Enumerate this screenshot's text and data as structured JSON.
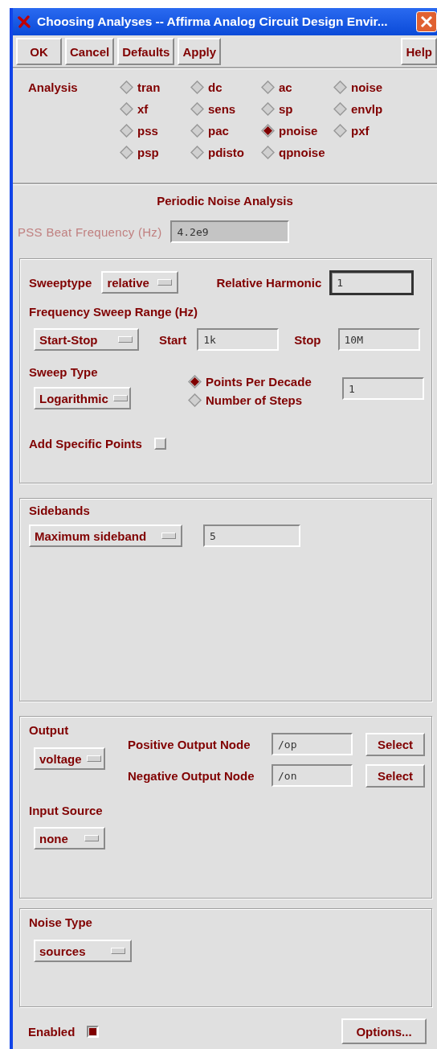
{
  "window": {
    "title": "Choosing Analyses -- Affirma Analog Circuit Design Envir..."
  },
  "buttons": [
    {
      "label": "OK"
    },
    {
      "label": "Cancel"
    },
    {
      "label": "Defaults"
    },
    {
      "label": "Apply"
    }
  ],
  "help_button": {
    "label": "Help"
  },
  "analysis": {
    "label": "Analysis",
    "options": [
      {
        "label": "tran",
        "selected": false
      },
      {
        "label": "dc",
        "selected": false
      },
      {
        "label": "ac",
        "selected": false
      },
      {
        "label": "noise",
        "selected": false
      },
      {
        "label": "xf",
        "selected": false
      },
      {
        "label": "sens",
        "selected": false
      },
      {
        "label": "sp",
        "selected": false
      },
      {
        "label": "envlp",
        "selected": false
      },
      {
        "label": "pss",
        "selected": false
      },
      {
        "label": "pac",
        "selected": false
      },
      {
        "label": "pnoise",
        "selected": true
      },
      {
        "label": "pxf",
        "selected": false
      },
      {
        "label": "psp",
        "selected": false
      },
      {
        "label": "pdisto",
        "selected": false
      },
      {
        "label": "qpnoise",
        "selected": false
      }
    ]
  },
  "heading": "Periodic Noise Analysis",
  "beat_frequency": {
    "label": "PSS Beat Frequency (Hz)",
    "value": "4.2e9",
    "disabled": true
  },
  "sweep": {
    "sweeptype_label": "Sweeptype",
    "sweeptype": "relative",
    "harmonic_label": "Relative Harmonic",
    "harmonic": {
      "value": "1",
      "focused": true
    },
    "range_label": "Frequency Sweep Range (Hz)",
    "range_mode": "Start-Stop",
    "start_label": "Start",
    "start": "1k",
    "stop_label": "Stop",
    "stop": "10M",
    "sweep_type_label": "Sweep Type",
    "sweep_type": "Logarithmic",
    "step_options": [
      {
        "label": "Points Per Decade",
        "selected": true
      },
      {
        "label": "Number of Steps",
        "selected": false
      }
    ],
    "steps": "1",
    "specific_points": {
      "label": "Add Specific Points",
      "checked": false
    }
  },
  "sidebands": {
    "label": "Sidebands",
    "mode": "Maximum sideband",
    "value": "5"
  },
  "output": {
    "label": "Output",
    "type": "voltage",
    "positive_label": "Positive Output Node",
    "positive": "/op",
    "negative_label": "Negative Output Node",
    "negative": "/on",
    "select_buttons": [
      "Select",
      "Select"
    ],
    "input_source_label": "Input Source",
    "input_source": "none"
  },
  "noise_type": {
    "label": "Noise Type",
    "value": "sources"
  },
  "enabled": {
    "label": "Enabled",
    "checked": true
  },
  "options_button": "Options..."
}
